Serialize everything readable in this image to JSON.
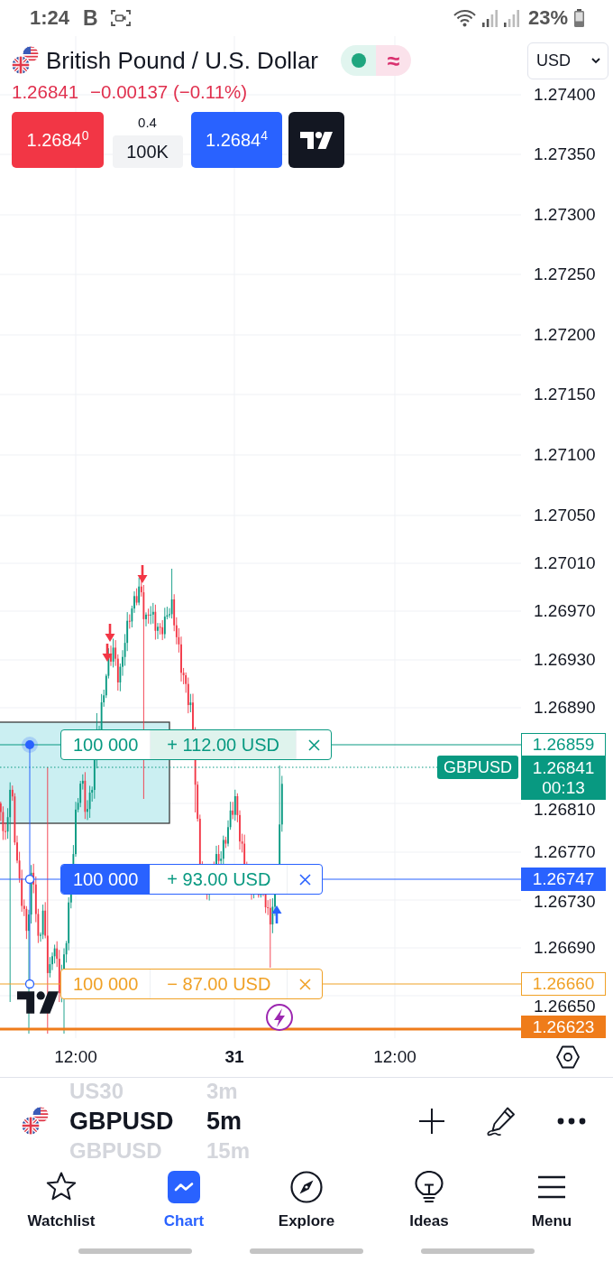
{
  "status_bar": {
    "time": "1:24",
    "notification": "B",
    "battery": "23%"
  },
  "header": {
    "title": "British Pound / U.S. Dollar",
    "status_symbol": "≈",
    "last_price": "1.26841",
    "change": "−0.00137 (−0.11%)",
    "currency": {
      "value": "USD"
    }
  },
  "trade_panel": {
    "sell": "1.2684$^{0}$",
    "spread": "0.4",
    "quantity": "100K",
    "buy": "1.2684$^{4}$"
  },
  "chart": {
    "price_axis": [
      "1.27400",
      "1.27350",
      "1.27300",
      "1.27250",
      "1.27200",
      "1.27150",
      "1.27100",
      "1.27050",
      "1.27010",
      "1.26970",
      "1.26930",
      "1.26890",
      "1.26810",
      "1.26770",
      "1.26730",
      "1.26690",
      "1.26650"
    ],
    "orders": [
      {
        "kind": "take_profit",
        "quantity": "100 000",
        "pnl": "+ 112.00 USD",
        "price": "1.26859"
      },
      {
        "kind": "position",
        "quantity": "100 000",
        "pnl": "+ 93.00 USD",
        "price": "1.26747"
      },
      {
        "kind": "stop_loss",
        "quantity": "100 000",
        "pnl": "− 87.00 USD",
        "price": "1.26660"
      }
    ],
    "last_price": {
      "symbol": "GBPUSD",
      "price": "1.26841",
      "countdown": "00:13"
    },
    "price_marker": {
      "price": "1.26623"
    },
    "time_axis": [
      {
        "kind": "time",
        "label": "12:00"
      },
      {
        "kind": "date",
        "label": "31"
      },
      {
        "kind": "time",
        "label": "12:00"
      }
    ]
  },
  "symbol_picker": {
    "items": [
      {
        "symbol": "US30",
        "interval": "3m",
        "selected": false
      },
      {
        "symbol": "GBPUSD",
        "interval": "5m",
        "selected": true
      },
      {
        "symbol": "GBPUSD",
        "interval": "15m",
        "selected": false
      }
    ]
  },
  "nav": {
    "items": [
      {
        "label": "Watchlist",
        "selected": false
      },
      {
        "label": "Chart",
        "selected": true
      },
      {
        "label": "Explore",
        "selected": false
      },
      {
        "label": "Ideas",
        "selected": false
      },
      {
        "label": "Menu",
        "selected": false
      }
    ]
  }
}
